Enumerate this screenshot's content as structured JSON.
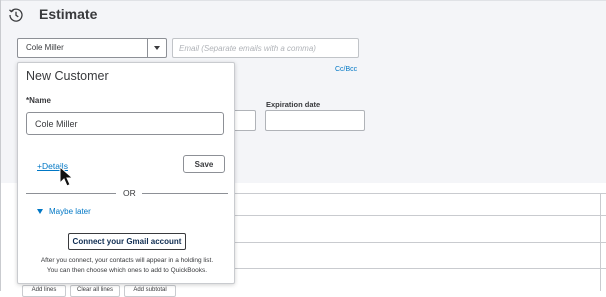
{
  "header": {
    "title": "Estimate",
    "icon": "history-icon"
  },
  "customer": {
    "selected": "Cole Miller"
  },
  "email": {
    "placeholder": "Email (Separate emails with a comma)"
  },
  "ccbcc_label": "Cc/Bcc",
  "expiration": {
    "label": "Expiration date"
  },
  "new_customer_panel": {
    "title": "New Customer",
    "name_label": "*Name",
    "name_value": "Cole Miller",
    "details_link": "+Details",
    "save_label": "Save",
    "or_label": "OR",
    "maybe_later": "Maybe later",
    "connect_gmail": "Connect your Gmail account",
    "footnote_line1": "After you connect, your contacts will appear in a holding list.",
    "footnote_line2": "You can then choose which ones to add to QuickBooks."
  },
  "bottom_actions": [
    "Add lines",
    "Clear all lines",
    "Add subtotal"
  ],
  "colors": {
    "link": "#0077c5",
    "text": "#393a3d",
    "gray_bg": "#f4f5f8"
  }
}
